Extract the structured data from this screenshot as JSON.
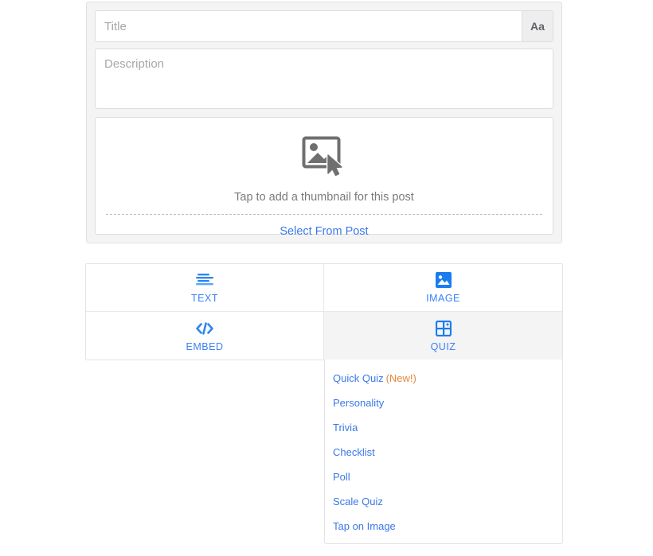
{
  "composer": {
    "title_value": "",
    "title_placeholder": "Title",
    "font_button_label": "Aa",
    "description_value": "",
    "description_placeholder": "Description"
  },
  "thumbnail": {
    "icon": "image-placeholder-icon",
    "cursor_icon": "cursor-arrow-icon",
    "caption": "Tap to add a thumbnail for this post",
    "select_link": "Select From Post"
  },
  "tabs": [
    {
      "label": "TEXT",
      "icon": "text-lines-icon",
      "active": false
    },
    {
      "label": "IMAGE",
      "icon": "image-icon",
      "active": false
    },
    {
      "label": "EMBED",
      "icon": "code-embed-icon",
      "active": false
    },
    {
      "label": "QUIZ",
      "icon": "grid-quiz-icon",
      "active": true
    }
  ],
  "quiz_menu": {
    "items": [
      {
        "label": "Quick Quiz",
        "badge": "(New!)"
      },
      {
        "label": "Personality",
        "badge": ""
      },
      {
        "label": "Trivia",
        "badge": ""
      },
      {
        "label": "Checklist",
        "badge": ""
      },
      {
        "label": "Poll",
        "badge": ""
      },
      {
        "label": "Scale Quiz",
        "badge": ""
      },
      {
        "label": "Tap on Image",
        "badge": ""
      }
    ]
  },
  "colors": {
    "accent_blue": "#3b82f6",
    "link_blue": "#3b78e7",
    "new_orange": "#e8873a",
    "panel_gray": "#f4f4f4",
    "border_gray": "#e0e0e0",
    "muted_text": "#7b7b7b"
  }
}
